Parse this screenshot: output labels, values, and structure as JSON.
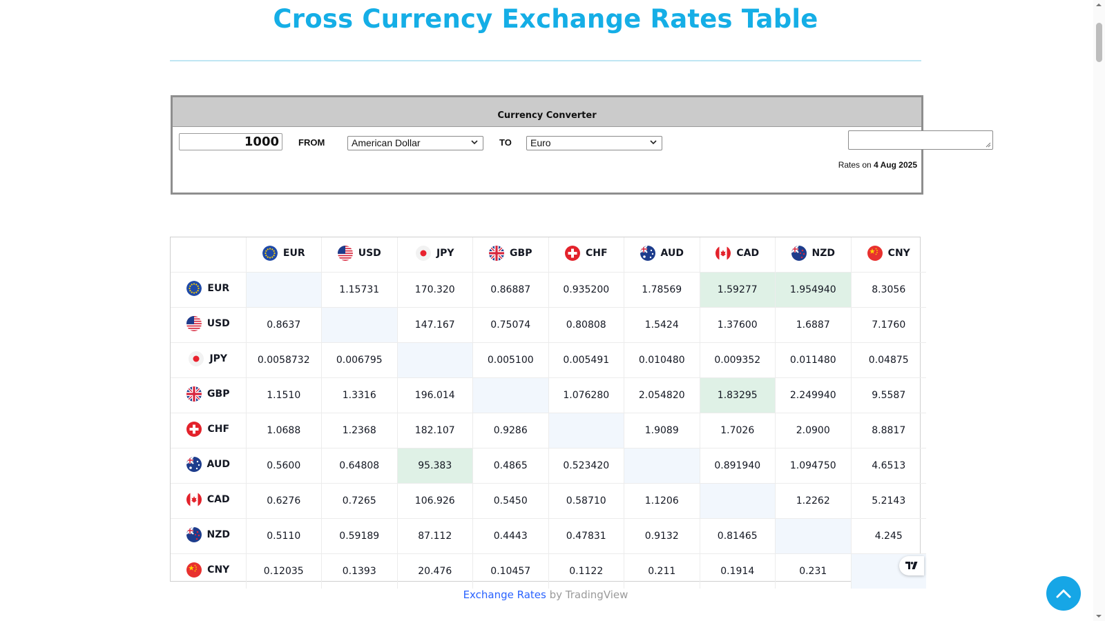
{
  "page": {
    "title": "Cross Currency Exchange Rates Table"
  },
  "converter": {
    "header": "Currency Converter",
    "amount": "1000",
    "from_label": "FROM",
    "from_value": "American Dollar",
    "to_label": "TO",
    "to_value": "Euro",
    "result": "",
    "rates_on_prefix": "Rates on",
    "rates_date": "4 Aug 2025"
  },
  "table": {
    "currencies": [
      "EUR",
      "USD",
      "JPY",
      "GBP",
      "CHF",
      "AUD",
      "CAD",
      "NZD",
      "CNY"
    ],
    "rows": [
      {
        "code": "EUR",
        "cells": [
          "",
          "1.15731",
          "170.320",
          "0.86887",
          "0.935200",
          "1.78569",
          "1.59277",
          "1.954940",
          "8.3056"
        ],
        "highlight": [
          6,
          7
        ]
      },
      {
        "code": "USD",
        "cells": [
          "0.8637",
          "",
          "147.167",
          "0.75074",
          "0.80808",
          "1.5424",
          "1.37600",
          "1.6887",
          "7.1760"
        ],
        "highlight": []
      },
      {
        "code": "JPY",
        "cells": [
          "0.0058732",
          "0.006795",
          "",
          "0.005100",
          "0.005491",
          "0.010480",
          "0.009352",
          "0.011480",
          "0.04875"
        ],
        "highlight": []
      },
      {
        "code": "GBP",
        "cells": [
          "1.1510",
          "1.3316",
          "196.014",
          "",
          "1.076280",
          "2.054820",
          "1.83295",
          "2.249940",
          "9.5587"
        ],
        "highlight": [
          6
        ]
      },
      {
        "code": "CHF",
        "cells": [
          "1.0688",
          "1.2368",
          "182.107",
          "0.9286",
          "",
          "1.9089",
          "1.7026",
          "2.0900",
          "8.8817"
        ],
        "highlight": []
      },
      {
        "code": "AUD",
        "cells": [
          "0.5600",
          "0.64808",
          "95.383",
          "0.4865",
          "0.523420",
          "",
          "0.891940",
          "1.094750",
          "4.6513"
        ],
        "highlight": [
          2
        ]
      },
      {
        "code": "CAD",
        "cells": [
          "0.6276",
          "0.7265",
          "106.926",
          "0.5450",
          "0.58710",
          "1.1206",
          "",
          "1.2262",
          "5.2143"
        ],
        "highlight": []
      },
      {
        "code": "NZD",
        "cells": [
          "0.5110",
          "0.59189",
          "87.112",
          "0.4443",
          "0.47831",
          "0.9132",
          "0.81465",
          "",
          "4.245"
        ],
        "highlight": []
      },
      {
        "code": "CNY",
        "cells": [
          "0.12035",
          "0.1393",
          "20.476",
          "0.10457",
          "0.1122",
          "0.211",
          "0.1914",
          "0.231",
          ""
        ],
        "highlight": []
      }
    ]
  },
  "attribution": {
    "link_text": "Exchange Rates",
    "by_text": " by TradingView"
  },
  "icons": {
    "scroll_top": "chevron-up-icon",
    "tradingview": "tradingview-logo-icon"
  },
  "colors": {
    "title": "#15aee6",
    "highlight_cell": "#dff1e6",
    "diagonal_cell": "#f2f7fd",
    "link": "#2962ff",
    "scroll_top_bg": "#16a6e6"
  }
}
